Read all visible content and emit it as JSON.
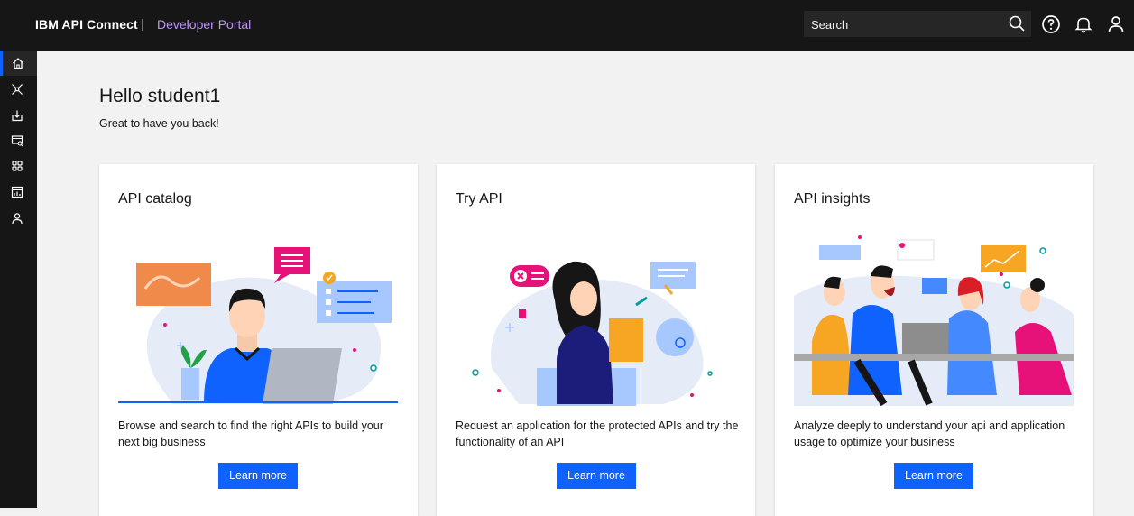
{
  "header": {
    "brand": "IBM API Connect",
    "separator": "|",
    "portal": "Developer Portal",
    "search_placeholder": "Search"
  },
  "sidebar": {
    "items": [
      {
        "icon": "home-icon",
        "active": true
      },
      {
        "icon": "apis-icon",
        "active": false
      },
      {
        "icon": "download-icon",
        "active": false
      },
      {
        "icon": "catalog-search-icon",
        "active": false
      },
      {
        "icon": "apps-icon",
        "active": false
      },
      {
        "icon": "analytics-icon",
        "active": false
      },
      {
        "icon": "user-icon",
        "active": false
      }
    ]
  },
  "main": {
    "greeting": "Hello student1",
    "subgreeting": "Great to have you back!",
    "cards": [
      {
        "title": "API catalog",
        "description": "Browse and search to find the right APIs to build your next big business",
        "button": "Learn more"
      },
      {
        "title": "Try API",
        "description": "Request an application for the protected APIs and try the functionality of an API",
        "button": "Learn more"
      },
      {
        "title": "API insights",
        "description": "Analyze deeply to understand your api and application usage to optimize your business",
        "button": "Learn more"
      }
    ]
  },
  "colors": {
    "topbar": "#161616",
    "accent": "#0f62fe",
    "portal_text": "#be95ff",
    "background": "#f2f2f2"
  }
}
